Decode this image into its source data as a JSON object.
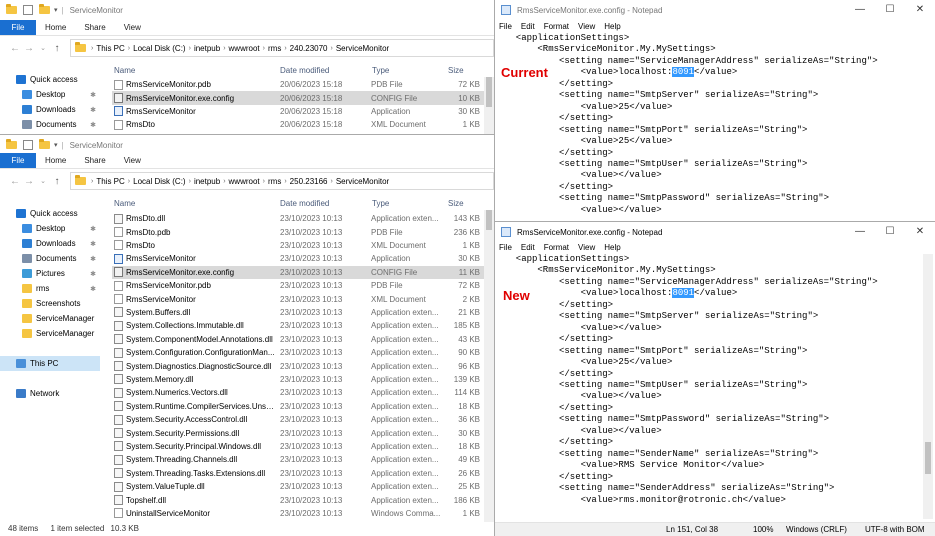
{
  "explorer_top": {
    "title": "ServiceMonitor",
    "ribbon": {
      "file": "File",
      "tabs": [
        "Home",
        "Share",
        "View"
      ]
    },
    "address": [
      "This PC",
      "Local Disk (C:)",
      "inetpub",
      "wwwroot",
      "rms",
      "240.23070",
      "ServiceMonitor"
    ],
    "columns": {
      "name": "Name",
      "date": "Date modified",
      "type": "Type",
      "size": "Size"
    },
    "nav": [
      {
        "label": "Quick access",
        "icon": "star-icon"
      },
      {
        "label": "Desktop",
        "icon": "desktop-icon"
      },
      {
        "label": "Downloads",
        "icon": "download-icon"
      },
      {
        "label": "Documents",
        "icon": "document-icon"
      }
    ],
    "rows": [
      {
        "name": "RmsServiceMonitor.pdb",
        "date": "20/06/2023 15:18",
        "type": "PDB File",
        "size": "72 KB",
        "icon": "file-icon"
      },
      {
        "name": "RmsServiceMonitor.exe.config",
        "date": "20/06/2023 15:18",
        "type": "CONFIG File",
        "size": "10 KB",
        "icon": "config-file-icon",
        "selected": true
      },
      {
        "name": "RmsServiceMonitor",
        "date": "20/06/2023 15:18",
        "type": "Application",
        "size": "30 KB",
        "icon": "application-icon"
      },
      {
        "name": "RmsDto",
        "date": "20/06/2023 15:18",
        "type": "XML Document",
        "size": "1 KB",
        "icon": "xml-file-icon"
      }
    ]
  },
  "explorer_bottom": {
    "title": "ServiceMonitor",
    "ribbon": {
      "file": "File",
      "tabs": [
        "Home",
        "Share",
        "View"
      ]
    },
    "address": [
      "This PC",
      "Local Disk (C:)",
      "inetpub",
      "wwwroot",
      "rms",
      "250.23166",
      "ServiceMonitor"
    ],
    "columns": {
      "name": "Name",
      "date": "Date modified",
      "type": "Type",
      "size": "Size"
    },
    "nav": [
      {
        "label": "Quick access",
        "icon": "star-icon"
      },
      {
        "label": "Desktop",
        "icon": "desktop-icon",
        "pinned": true
      },
      {
        "label": "Downloads",
        "icon": "download-icon",
        "pinned": true
      },
      {
        "label": "Documents",
        "icon": "document-icon",
        "pinned": true
      },
      {
        "label": "Pictures",
        "icon": "pictures-icon",
        "pinned": true
      },
      {
        "label": "rms",
        "icon": "folder-icon",
        "pinned": true
      },
      {
        "label": "Screenshots",
        "icon": "folder-icon"
      },
      {
        "label": "ServiceManager",
        "icon": "folder-icon"
      },
      {
        "label": "ServiceManager",
        "icon": "folder-icon"
      },
      {
        "label": "",
        "icon": ""
      },
      {
        "label": "This PC",
        "icon": "computer-icon",
        "selected": true
      },
      {
        "label": "",
        "icon": ""
      },
      {
        "label": "Network",
        "icon": "network-icon"
      }
    ],
    "rows": [
      {
        "name": "RmsDto.dll",
        "date": "23/10/2023 10:13",
        "type": "Application exten...",
        "size": "143 KB",
        "icon": "dll-icon"
      },
      {
        "name": "RmsDto.pdb",
        "date": "23/10/2023 10:13",
        "type": "PDB File",
        "size": "236 KB",
        "icon": "file-icon"
      },
      {
        "name": "RmsDto",
        "date": "23/10/2023 10:13",
        "type": "XML Document",
        "size": "1 KB",
        "icon": "xml-file-icon"
      },
      {
        "name": "RmsServiceMonitor",
        "date": "23/10/2023 10:13",
        "type": "Application",
        "size": "30 KB",
        "icon": "application-icon"
      },
      {
        "name": "RmsServiceMonitor.exe.config",
        "date": "23/10/2023 10:13",
        "type": "CONFIG File",
        "size": "11 KB",
        "icon": "config-file-icon",
        "selected": true
      },
      {
        "name": "RmsServiceMonitor.pdb",
        "date": "23/10/2023 10:13",
        "type": "PDB File",
        "size": "72 KB",
        "icon": "file-icon"
      },
      {
        "name": "RmsServiceMonitor",
        "date": "23/10/2023 10:13",
        "type": "XML Document",
        "size": "2 KB",
        "icon": "xml-file-icon"
      },
      {
        "name": "System.Buffers.dll",
        "date": "23/10/2023 10:13",
        "type": "Application exten...",
        "size": "21 KB",
        "icon": "dll-icon"
      },
      {
        "name": "System.Collections.Immutable.dll",
        "date": "23/10/2023 10:13",
        "type": "Application exten...",
        "size": "185 KB",
        "icon": "dll-icon"
      },
      {
        "name": "System.ComponentModel.Annotations.dll",
        "date": "23/10/2023 10:13",
        "type": "Application exten...",
        "size": "43 KB",
        "icon": "dll-icon"
      },
      {
        "name": "System.Configuration.ConfigurationMan...",
        "date": "23/10/2023 10:13",
        "type": "Application exten...",
        "size": "90 KB",
        "icon": "dll-icon"
      },
      {
        "name": "System.Diagnostics.DiagnosticSource.dll",
        "date": "23/10/2023 10:13",
        "type": "Application exten...",
        "size": "96 KB",
        "icon": "dll-icon"
      },
      {
        "name": "System.Memory.dll",
        "date": "23/10/2023 10:13",
        "type": "Application exten...",
        "size": "139 KB",
        "icon": "dll-icon"
      },
      {
        "name": "System.Numerics.Vectors.dll",
        "date": "23/10/2023 10:13",
        "type": "Application exten...",
        "size": "114 KB",
        "icon": "dll-icon"
      },
      {
        "name": "System.Runtime.CompilerServices.Unsaf...",
        "date": "23/10/2023 10:13",
        "type": "Application exten...",
        "size": "18 KB",
        "icon": "dll-icon"
      },
      {
        "name": "System.Security.AccessControl.dll",
        "date": "23/10/2023 10:13",
        "type": "Application exten...",
        "size": "36 KB",
        "icon": "dll-icon"
      },
      {
        "name": "System.Security.Permissions.dll",
        "date": "23/10/2023 10:13",
        "type": "Application exten...",
        "size": "30 KB",
        "icon": "dll-icon"
      },
      {
        "name": "System.Security.Principal.Windows.dll",
        "date": "23/10/2023 10:13",
        "type": "Application exten...",
        "size": "18 KB",
        "icon": "dll-icon"
      },
      {
        "name": "System.Threading.Channels.dll",
        "date": "23/10/2023 10:13",
        "type": "Application exten...",
        "size": "49 KB",
        "icon": "dll-icon"
      },
      {
        "name": "System.Threading.Tasks.Extensions.dll",
        "date": "23/10/2023 10:13",
        "type": "Application exten...",
        "size": "26 KB",
        "icon": "dll-icon"
      },
      {
        "name": "System.ValueTuple.dll",
        "date": "23/10/2023 10:13",
        "type": "Application exten...",
        "size": "25 KB",
        "icon": "dll-icon"
      },
      {
        "name": "Topshelf.dll",
        "date": "23/10/2023 10:13",
        "type": "Application exten...",
        "size": "186 KB",
        "icon": "dll-icon"
      },
      {
        "name": "UninstallServiceMonitor",
        "date": "23/10/2023 10:13",
        "type": "Windows Comma...",
        "size": "1 KB",
        "icon": "script-file-icon"
      }
    ],
    "status": {
      "count": "48 items",
      "selected": "1 item selected",
      "size": "10.3 KB"
    }
  },
  "notepad_top": {
    "title": "RmsServiceMonitor.exe.config - Notepad",
    "menu": [
      "File",
      "Edit",
      "Format",
      "View",
      "Help"
    ],
    "label": "Current",
    "lines": [
      {
        "text": "  <applicationSettings>"
      },
      {
        "text": "      <RmsServiceMonitor.My.MySettings>"
      },
      {
        "text": "          <setting name=\"ServiceManagerAddress\" serializeAs=\"String\">"
      },
      {
        "pre": "              <value>localhost:",
        "hl": "8091",
        "post": "</value>"
      },
      {
        "text": "          </setting>"
      },
      {
        "text": "          <setting name=\"SmtpServer\" serializeAs=\"String\">"
      },
      {
        "text": "              <value>25</value>"
      },
      {
        "text": "          </setting>"
      },
      {
        "text": "          <setting name=\"SmtpPort\" serializeAs=\"String\">"
      },
      {
        "text": "              <value>25</value>"
      },
      {
        "text": "          </setting>"
      },
      {
        "text": "          <setting name=\"SmtpUser\" serializeAs=\"String\">"
      },
      {
        "text": "              <value></value>"
      },
      {
        "text": "          </setting>"
      },
      {
        "text": "          <setting name=\"SmtpPassword\" serializeAs=\"String\">"
      },
      {
        "text": "              <value></value>"
      }
    ]
  },
  "notepad_bottom": {
    "title": "RmsServiceMonitor.exe.config - Notepad",
    "menu": [
      "File",
      "Edit",
      "Format",
      "View",
      "Help"
    ],
    "label": "New",
    "lines": [
      {
        "text": "  <applicationSettings>"
      },
      {
        "text": "      <RmsServiceMonitor.My.MySettings>"
      },
      {
        "text": "          <setting name=\"ServiceManagerAddress\" serializeAs=\"String\">"
      },
      {
        "pre": "              <value>localhost:",
        "hl": "8091",
        "post": "</value>"
      },
      {
        "text": "          </setting>"
      },
      {
        "text": "          <setting name=\"SmtpServer\" serializeAs=\"String\">"
      },
      {
        "text": "              <value></value>"
      },
      {
        "text": "          </setting>"
      },
      {
        "text": "          <setting name=\"SmtpPort\" serializeAs=\"String\">"
      },
      {
        "text": "              <value>25</value>"
      },
      {
        "text": "          </setting>"
      },
      {
        "text": "          <setting name=\"SmtpUser\" serializeAs=\"String\">"
      },
      {
        "text": "              <value></value>"
      },
      {
        "text": "          </setting>"
      },
      {
        "text": "          <setting name=\"SmtpPassword\" serializeAs=\"String\">"
      },
      {
        "text": "              <value></value>"
      },
      {
        "text": "          </setting>"
      },
      {
        "text": "          <setting name=\"SenderName\" serializeAs=\"String\">"
      },
      {
        "text": "              <value>RMS Service Monitor</value>"
      },
      {
        "text": "          </setting>"
      },
      {
        "text": "          <setting name=\"SenderAddress\" serializeAs=\"String\">"
      },
      {
        "text": "              <value>rms.monitor@rotronic.ch</value>"
      }
    ],
    "status": {
      "position": "Ln 151, Col 38",
      "zoom": "100%",
      "eol": "Windows (CRLF)",
      "encoding": "UTF-8 with BOM"
    }
  }
}
